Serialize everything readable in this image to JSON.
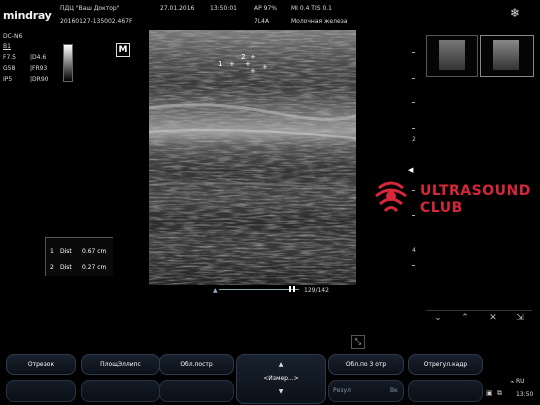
{
  "header": {
    "brand": "mindray",
    "facility": "ПДЦ \"Ваш Доктор\"",
    "patient_id": "20160127-135002.467F",
    "date": "27.01.2016",
    "time": "13:50:01",
    "ap": "AP  97%",
    "mi_tis": "MI 0.4  TIS 0.1",
    "probe": "7L4A",
    "exam": "Молочная железа",
    "settings_icon": "snowflake-icon"
  },
  "params": {
    "preset": "DC-N6",
    "mode": "B1",
    "rows": [
      {
        "left": "F7.5",
        "right": "D4.6"
      },
      {
        "left": "G58",
        "right": "FR93"
      },
      {
        "left": "IP5",
        "right": "DR90"
      }
    ],
    "mode_badge": "M"
  },
  "image": {
    "calipers": [
      "1",
      "2"
    ],
    "frame_counter": "129/142"
  },
  "measurements": [
    {
      "index": "1",
      "label": "Dist",
      "value": "0.67 cm"
    },
    {
      "index": "2",
      "label": "Dist",
      "value": "0.27 cm"
    }
  ],
  "depth_scale": {
    "labels": [
      "2",
      "4"
    ]
  },
  "watermark": {
    "line1": "ULTRASOUND",
    "line2": "CLUB"
  },
  "thumb_controls": [
    "chevron-double-down-icon",
    "chevron-double-up-icon",
    "close-icon",
    "export-icon"
  ],
  "softkeys": {
    "row1": [
      "Отрезок",
      "ПлощЭллипс",
      "Обл.постр",
      "Обл.по 3 отр",
      "Отрегул.кадр"
    ],
    "center": "<Измер...>",
    "row2_right": {
      "left": "Резул",
      "right": "Вк"
    }
  },
  "status": {
    "language": "RU",
    "clock": "13:50"
  },
  "colors": {
    "background": "#000000",
    "button": "#0f1722",
    "logo_red": "#d6263a"
  }
}
